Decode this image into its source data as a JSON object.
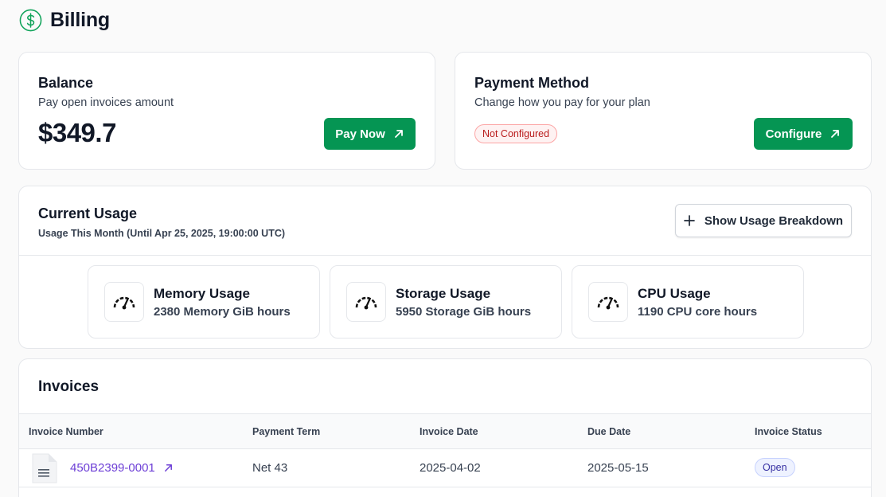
{
  "page": {
    "title": "Billing",
    "logo_icon": "dollar-circle-icon",
    "accent": "#059553"
  },
  "balance": {
    "title": "Balance",
    "subtitle": "Pay open invoices amount",
    "amount": "$349.7",
    "button_label": "Pay Now",
    "button_icon": "arrow-up-right-icon"
  },
  "payment_method": {
    "title": "Payment Method",
    "subtitle": "Change how you pay for your plan",
    "status": "Not Configured",
    "button_label": "Configure",
    "button_icon": "arrow-up-right-icon"
  },
  "usage": {
    "title": "Current Usage",
    "subtitle": "Usage This Month (Until Apr 25, 2025, 19:00:00 UTC)",
    "breakdown_button": "Show Usage Breakdown",
    "breakdown_icon": "plus-icon",
    "metrics": [
      {
        "title": "Memory Usage",
        "value": "2380 Memory GiB hours",
        "icon": "gauge-icon"
      },
      {
        "title": "Storage Usage",
        "value": "5950 Storage GiB hours",
        "icon": "gauge-icon"
      },
      {
        "title": "CPU Usage",
        "value": "1190 CPU core hours",
        "icon": "gauge-icon"
      }
    ]
  },
  "invoices": {
    "title": "Invoices",
    "columns": [
      "Invoice Number",
      "Payment Term",
      "Invoice Date",
      "Due Date",
      "Invoice Status"
    ],
    "rows": [
      {
        "number": "450B2399-0001",
        "term": "Net 43",
        "invoice_date": "2025-04-02",
        "due_date": "2025-05-15",
        "status": "Open",
        "icon": "document-icon"
      }
    ]
  }
}
